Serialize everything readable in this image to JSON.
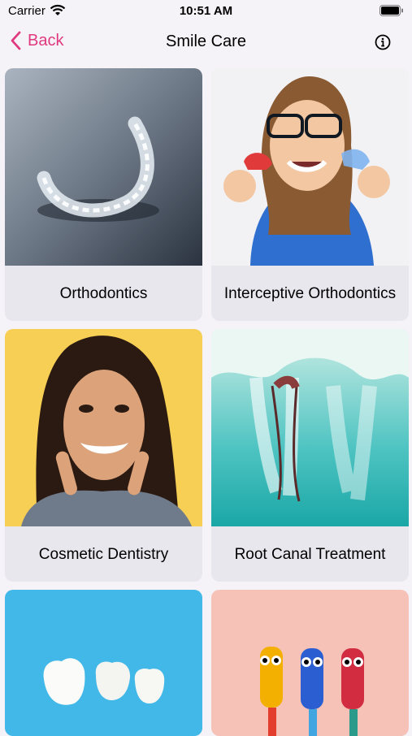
{
  "status_bar": {
    "carrier": "Carrier",
    "time": "10:51 AM"
  },
  "nav": {
    "back_label": "Back",
    "title": "Smile Care"
  },
  "services": [
    {
      "label": "Orthodontics"
    },
    {
      "label": "Interceptive Orthodontics"
    },
    {
      "label": "Cosmetic Dentistry"
    },
    {
      "label": "Root Canal Treatment"
    },
    {
      "label": ""
    },
    {
      "label": ""
    }
  ],
  "colors": {
    "accent": "#e0397f",
    "background": "#f5f3f7",
    "card": "#e9e7ee"
  },
  "icons": {
    "back": "chevron-left-icon",
    "info": "info-icon",
    "wifi": "wifi-icon",
    "battery": "battery-icon"
  }
}
